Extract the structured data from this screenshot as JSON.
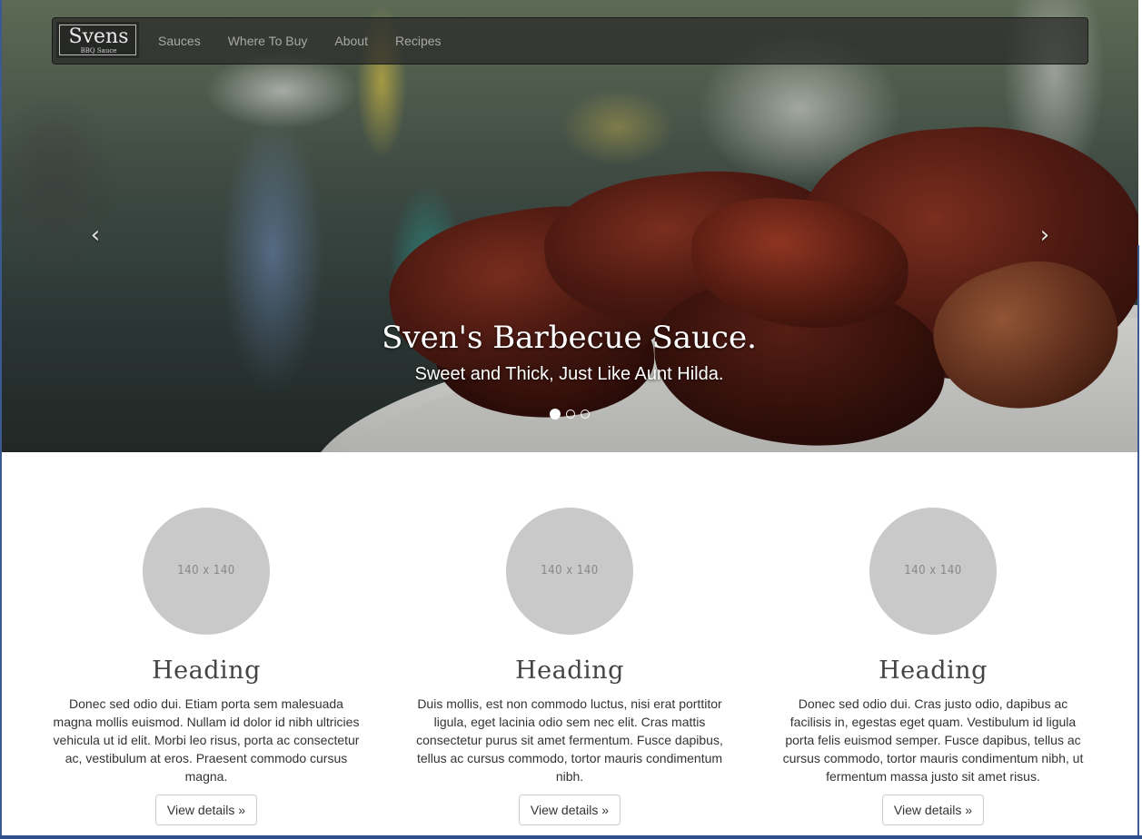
{
  "navbar": {
    "brand": {
      "name": "Svens",
      "tagline": "BBQ Sauce"
    },
    "links": [
      "Sauces",
      "Where To Buy",
      "About",
      "Recipes"
    ]
  },
  "carousel": {
    "prev_icon": "chevron-left-icon",
    "next_icon": "chevron-right-icon",
    "prev_glyph": "‹",
    "next_glyph": "›",
    "caption": {
      "title": "Sven's Barbecue Sauce.",
      "subtitle": "Sweet and Thick, Just Like Aunt Hilda."
    },
    "slides_count": 3,
    "active_slide": 1
  },
  "marketing": {
    "columns": [
      {
        "image_label": "140 x 140",
        "heading": "Heading",
        "text": "Donec sed odio dui. Etiam porta sem malesuada magna mollis euismod. Nullam id dolor id nibh ultricies vehicula ut id elit. Morbi leo risus, porta ac consectetur ac, vestibulum at eros. Praesent commodo cursus magna.",
        "button": "View details »"
      },
      {
        "image_label": "140 x 140",
        "heading": "Heading",
        "text": "Duis mollis, est non commodo luctus, nisi erat porttitor ligula, eget lacinia odio sem nec elit. Cras mattis consectetur purus sit amet fermentum. Fusce dapibus, tellus ac cursus commodo, tortor mauris condimentum nibh.",
        "button": "View details »"
      },
      {
        "image_label": "140 x 140",
        "heading": "Heading",
        "text": "Donec sed odio dui. Cras justo odio, dapibus ac facilisis in, egestas eget quam. Vestibulum id ligula porta felis euismod semper. Fusce dapibus, tellus ac cursus commodo, tortor mauris condimentum nibh, ut fermentum massa justo sit amet risus.",
        "button": "View details »"
      }
    ]
  },
  "colors": {
    "navbar_bg": "#282828",
    "nav_link": "#a8a8a8",
    "placeholder_bg": "#c9c9c9",
    "placeholder_text": "#888888",
    "frame": "#3b5a94"
  }
}
